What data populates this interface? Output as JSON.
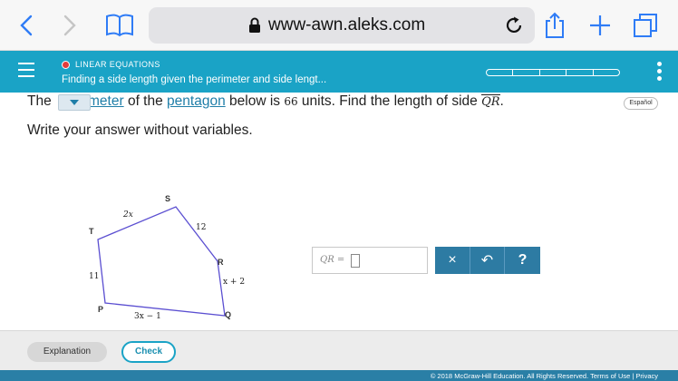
{
  "browser": {
    "url": "www-awn.aleks.com",
    "icons": [
      "back-icon",
      "forward-icon",
      "bookmarks-icon",
      "lock-icon",
      "reload-icon",
      "share-icon",
      "new-tab-icon",
      "tabs-icon"
    ]
  },
  "header": {
    "topic": "LINEAR EQUATIONS",
    "subtopic": "Finding a side length given the perimeter and side lengt...",
    "progress_segments": 5
  },
  "question": {
    "part1": "The ",
    "glossary_link": "meter",
    "part2": " of the ",
    "pentagon_link": "pentagon",
    "part3": " below is ",
    "perimeter_value": "66",
    "part4": " units. Find the length of side ",
    "side_name": "QR",
    "part5": ".",
    "espanol_label": "Español",
    "instruction": "Write your answer without variables."
  },
  "figure": {
    "vertices": {
      "S": "S",
      "T": "T",
      "R": "R",
      "P": "P",
      "Q": "Q"
    },
    "sides": {
      "TS": "2x",
      "SR": "12",
      "RQ": "x + 2",
      "PQ": "3x − 1",
      "TP": "11"
    }
  },
  "answer": {
    "prefix": "QR =",
    "clear_symbol": "×",
    "undo_symbol": "↶",
    "help_symbol": "?"
  },
  "bottom": {
    "explanation_label": "Explanation",
    "check_label": "Check"
  },
  "footer": {
    "text": "© 2018 McGraw-Hill Education. All Rights Reserved.   Terms of Use   |   Privacy"
  },
  "colors": {
    "aleks_teal": "#1aa3c6",
    "link_blue": "#1f7ea8",
    "button_blue": "#2d7ba3",
    "pentagon_stroke": "#5b4fd1"
  }
}
